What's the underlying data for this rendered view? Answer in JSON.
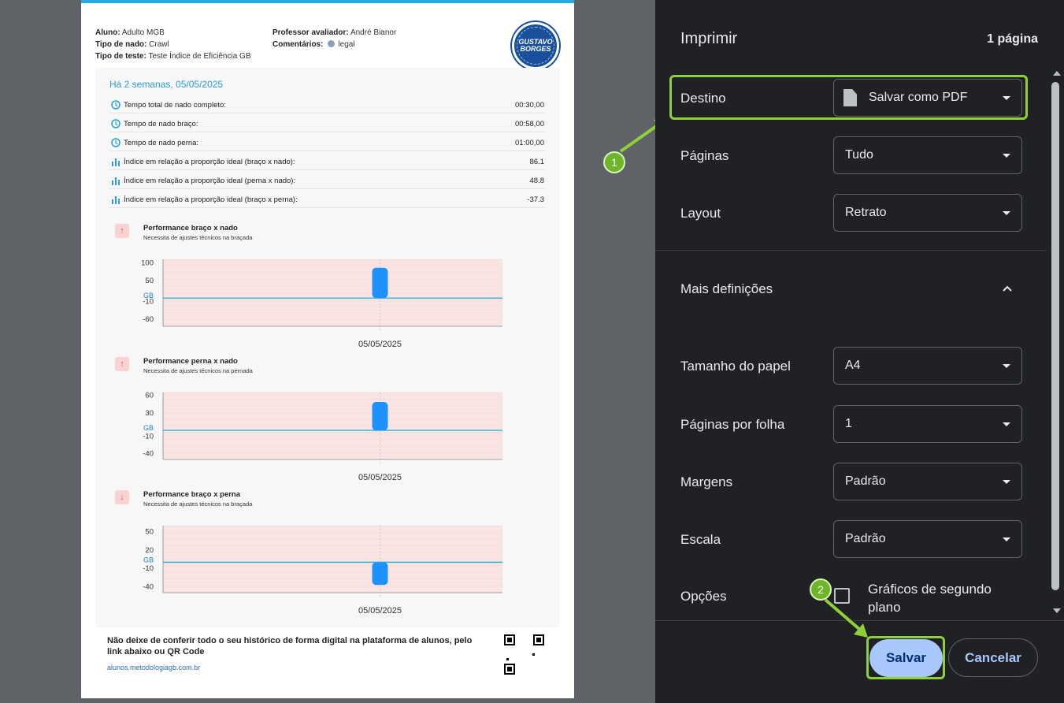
{
  "document": {
    "header": {
      "aluno_label": "Aluno:",
      "aluno_value": "Adulto MGB",
      "tipo_nado_label": "Tipo de nado:",
      "tipo_nado_value": "Crawl",
      "tipo_teste_label": "Tipo de teste:",
      "tipo_teste_value": "Teste Índice de Eficiência GB",
      "professor_label": "Professor avaliador:",
      "professor_value": "André Bianor",
      "comentarios_label": "Comentários:",
      "comentarios_value": "legal",
      "logo_name": "GUSTAVO BORGES"
    },
    "date_heading": "Há 2 semanas, 05/05/2025",
    "metrics": [
      {
        "icon": "clock-icon",
        "label": "Tempo total de nado completo:",
        "value": "00:30,00"
      },
      {
        "icon": "clock-icon",
        "label": "Tempo de nado braço:",
        "value": "00:58,00"
      },
      {
        "icon": "clock-icon",
        "label": "Tempo de nado perna:",
        "value": "01:00,00"
      },
      {
        "icon": "bar-chart-icon",
        "label": "Índice em relação a proporção ideal (braço x nado):",
        "value": "86.1"
      },
      {
        "icon": "bar-chart-icon",
        "label": "Índice em relação a proporção ideal (perna x nado):",
        "value": "48.8"
      },
      {
        "icon": "bar-chart-icon",
        "label": "Índice em relação a proporção ideal (braço x perna):",
        "value": "-37.3"
      }
    ],
    "charts": [
      {
        "arrow": "↑",
        "title": "Performance braço x nado",
        "subtitle": "Necessita de ajustes técnicos na braçada",
        "ref_label": "GB"
      },
      {
        "arrow": "↑",
        "title": "Performance perna x nado",
        "subtitle": "Necessita de ajustes técnicos na pernada",
        "ref_label": "GB"
      },
      {
        "arrow": "↓",
        "title": "Performance braço x perna",
        "subtitle": "Necessita de ajustes técnicos na braçada",
        "ref_label": "GB"
      }
    ],
    "footer": {
      "text": "Não deixe de conferir todo o seu histórico de forma digital na plataforma de alunos, pelo link abaixo ou QR Code",
      "link": "alunos.metodologiagb.com.br"
    }
  },
  "chart_data": [
    {
      "type": "bar",
      "title": "Performance braço x nado",
      "categories": [
        "05/05/2025"
      ],
      "values": [
        86.1
      ],
      "yticks": [
        100,
        50,
        -10,
        -60
      ],
      "reference_line": {
        "label": "GB",
        "value": 0
      },
      "ylim": [
        -80,
        110
      ]
    },
    {
      "type": "bar",
      "title": "Performance perna x nado",
      "categories": [
        "05/05/2025"
      ],
      "values": [
        48.8
      ],
      "yticks": [
        60,
        30,
        -10,
        -40
      ],
      "reference_line": {
        "label": "GB",
        "value": 0
      },
      "ylim": [
        -50,
        65
      ]
    },
    {
      "type": "bar",
      "title": "Performance braço x perna",
      "categories": [
        "05/05/2025"
      ],
      "values": [
        -37.3
      ],
      "yticks": [
        50,
        20,
        -10,
        -40
      ],
      "reference_line": {
        "label": "GB",
        "value": 0
      },
      "ylim": [
        -50,
        60
      ]
    }
  ],
  "print_dialog": {
    "title": "Imprimir",
    "page_count": "1 página",
    "settings": [
      {
        "key": "destino",
        "label": "Destino",
        "value": "Salvar como PDF"
      },
      {
        "key": "paginas",
        "label": "Páginas",
        "value": "Tudo"
      },
      {
        "key": "layout",
        "label": "Layout",
        "value": "Retrato"
      }
    ],
    "more_settings": "Mais definições",
    "more_settings_list": [
      {
        "key": "papel",
        "label": "Tamanho do papel",
        "value": "A4"
      },
      {
        "key": "por-folha",
        "label": "Páginas por folha",
        "value": "1"
      },
      {
        "key": "margens",
        "label": "Margens",
        "value": "Padrão"
      },
      {
        "key": "escala",
        "label": "Escala",
        "value": "Padrão"
      }
    ],
    "options_label": "Opções",
    "background_graphics": "Gráficos de segundo plano",
    "background_graphics_checked": false,
    "save": "Salvar",
    "cancel": "Cancelar"
  },
  "annotations": {
    "step1": "1",
    "step2": "2",
    "color": "#8ed03a"
  }
}
